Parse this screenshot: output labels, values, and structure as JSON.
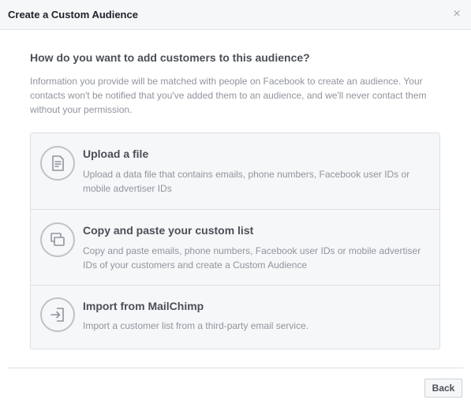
{
  "dialog": {
    "title": "Create a Custom Audience",
    "close_icon": "close-icon"
  },
  "main": {
    "question": "How do you want to add customers to this audience?",
    "info": "Information you provide will be matched with people on Facebook to create an audience. Your contacts won't be notified that you've added them to an audience, and we'll never contact them without your permission."
  },
  "options": [
    {
      "icon": "file-icon",
      "title": "Upload a file",
      "description": "Upload a data file that contains emails, phone numbers, Facebook user IDs or mobile advertiser IDs"
    },
    {
      "icon": "copy-paste-icon",
      "title": "Copy and paste your custom list",
      "description": "Copy and paste emails, phone numbers, Facebook user IDs or mobile advertiser IDs of your customers and create a Custom Audience"
    },
    {
      "icon": "import-icon",
      "title": "Import from MailChimp",
      "description": "Import a customer list from a third-party email service."
    }
  ],
  "footer": {
    "back_label": "Back"
  },
  "colors": {
    "header_bg": "#f6f7f9",
    "option_bg": "#f6f7f9",
    "border": "#dddfe2",
    "title_text": "#4b4f56",
    "muted_text": "#90949c",
    "icon_stroke": "#bec2c9"
  }
}
